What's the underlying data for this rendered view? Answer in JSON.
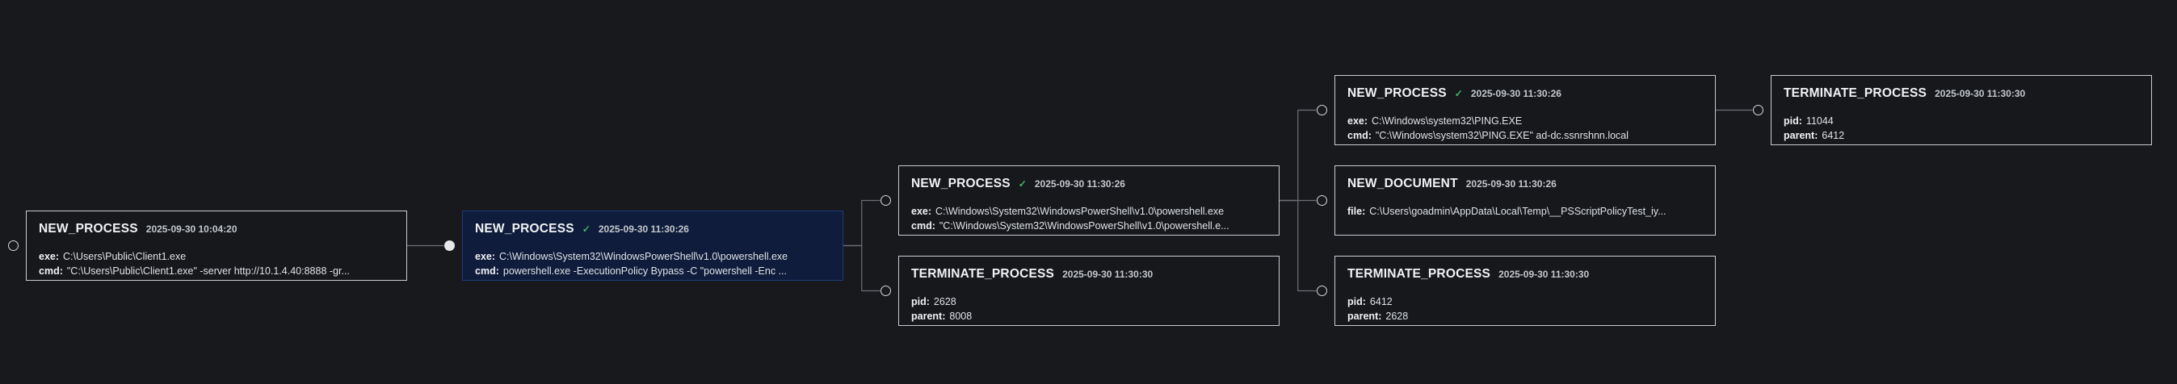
{
  "nodes": [
    {
      "id": "n1",
      "type": "NEW_PROCESS",
      "verified": false,
      "timestamp": "2025-09-30 10:04:20",
      "selected": false,
      "fields": [
        {
          "key": "exe",
          "value": "C:\\Users\\Public\\Client1.exe"
        },
        {
          "key": "cmd",
          "value": "\"C:\\Users\\Public\\Client1.exe\" -server http://10.1.4.40:8888 -gr..."
        }
      ]
    },
    {
      "id": "n2",
      "type": "NEW_PROCESS",
      "verified": true,
      "timestamp": "2025-09-30 11:30:26",
      "selected": true,
      "fields": [
        {
          "key": "exe",
          "value": "C:\\Windows\\System32\\WindowsPowerShell\\v1.0\\powershell.exe"
        },
        {
          "key": "cmd",
          "value": "powershell.exe -ExecutionPolicy Bypass -C \"powershell -Enc ..."
        }
      ]
    },
    {
      "id": "n3",
      "type": "NEW_PROCESS",
      "verified": true,
      "timestamp": "2025-09-30 11:30:26",
      "selected": false,
      "fields": [
        {
          "key": "exe",
          "value": "C:\\Windows\\System32\\WindowsPowerShell\\v1.0\\powershell.exe"
        },
        {
          "key": "cmd",
          "value": "\"C:\\Windows\\System32\\WindowsPowerShell\\v1.0\\powershell.e..."
        }
      ]
    },
    {
      "id": "n4",
      "type": "TERMINATE_PROCESS",
      "verified": false,
      "timestamp": "2025-09-30 11:30:30",
      "selected": false,
      "fields": [
        {
          "key": "pid",
          "value": "2628"
        },
        {
          "key": "parent",
          "value": "8008"
        }
      ]
    },
    {
      "id": "n5",
      "type": "NEW_PROCESS",
      "verified": true,
      "timestamp": "2025-09-30 11:30:26",
      "selected": false,
      "fields": [
        {
          "key": "exe",
          "value": "C:\\Windows\\system32\\PING.EXE"
        },
        {
          "key": "cmd",
          "value": "\"C:\\Windows\\system32\\PING.EXE\" ad-dc.ssnrshnn.local"
        }
      ]
    },
    {
      "id": "n6",
      "type": "NEW_DOCUMENT",
      "verified": false,
      "timestamp": "2025-09-30 11:30:26",
      "selected": false,
      "fields": [
        {
          "key": "file",
          "value": "C:\\Users\\goadmin\\AppData\\Local\\Temp\\__PSScriptPolicyTest_iy..."
        }
      ]
    },
    {
      "id": "n7",
      "type": "TERMINATE_PROCESS",
      "verified": false,
      "timestamp": "2025-09-30 11:30:30",
      "selected": false,
      "fields": [
        {
          "key": "pid",
          "value": "6412"
        },
        {
          "key": "parent",
          "value": "2628"
        }
      ]
    },
    {
      "id": "n8",
      "type": "TERMINATE_PROCESS",
      "verified": false,
      "timestamp": "2025-09-30 11:30:30",
      "selected": false,
      "fields": [
        {
          "key": "pid",
          "value": "11044"
        },
        {
          "key": "parent",
          "value": "6412"
        }
      ]
    }
  ],
  "edges": [
    {
      "from": "n1",
      "to": "n2"
    },
    {
      "from": "n2",
      "to": "n3"
    },
    {
      "from": "n2",
      "to": "n4"
    },
    {
      "from": "n3",
      "to": "n5"
    },
    {
      "from": "n3",
      "to": "n6"
    },
    {
      "from": "n3",
      "to": "n7"
    },
    {
      "from": "n5",
      "to": "n8"
    }
  ],
  "colors": {
    "background": "#17191d",
    "node_border": "#c9ccd1",
    "selected_background": "#0f1c3c",
    "edge": "#6b6f76",
    "check": "#3fb96a"
  },
  "icons": {
    "verified": "check-icon",
    "port": "circle-port-icon"
  },
  "check_glyph": "✓"
}
